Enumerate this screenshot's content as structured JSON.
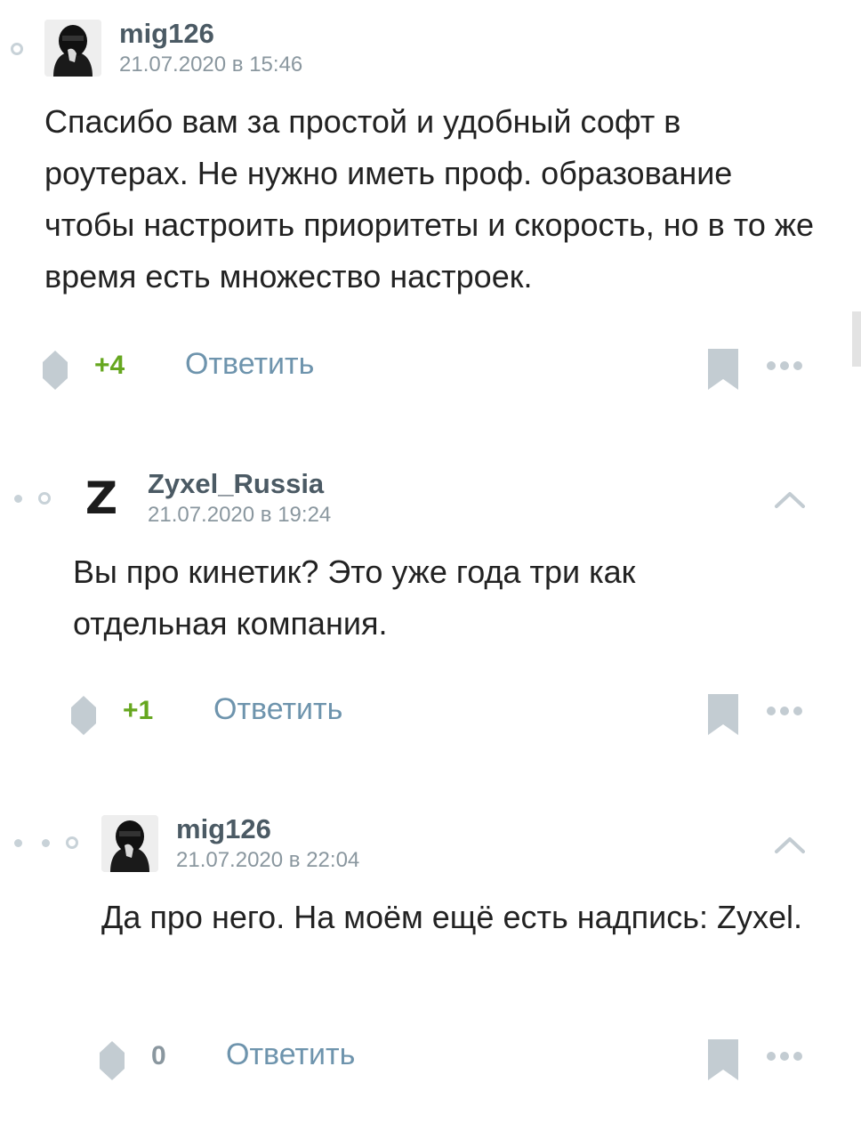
{
  "comments": [
    {
      "author": "mig126",
      "date": "21.07.2020 в 15:46",
      "text": "Спасибо вам за простой и удобный софт в роутерах. Не нужно иметь проф. образование чтобы настроить приоритеты и скорость, но в то же время есть множество настроек.",
      "score": "+4",
      "score_color": "#66a71f",
      "reply_label": "Ответить",
      "avatar_icon": "masked-person-avatar"
    },
    {
      "author": "Zyxel_Russia",
      "date": "21.07.2020 в 19:24",
      "text": "Вы про кинетик? Это уже года три как отдельная компания.",
      "score": "+1",
      "score_color": "#66a71f",
      "reply_label": "Ответить",
      "avatar_icon": "zyxel-logo",
      "avatar_letter": "Z"
    },
    {
      "author": "mig126",
      "date": "21.07.2020 в 22:04",
      "text": "Да про него. На моём ещё есть надпись: Zyxel.",
      "score": "0",
      "score_color": "#8a979f",
      "reply_label": "Ответить",
      "avatar_icon": "masked-person-avatar"
    }
  ],
  "colors": {
    "icon_gray": "#c3ccd2",
    "reply_blue": "#6e94ad",
    "author_gray": "#4b5a64",
    "positive_green": "#66a71f"
  }
}
